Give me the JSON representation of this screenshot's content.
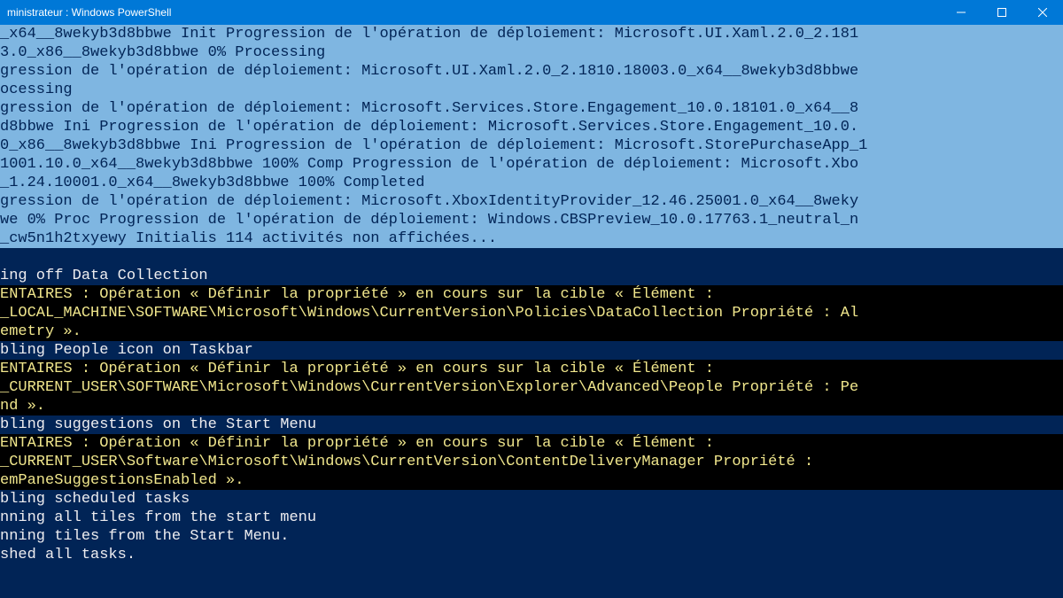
{
  "titlebar": {
    "title": "ministrateur : Windows PowerShell"
  },
  "terminal": {
    "selected_lines": [
      "_x64__8wekyb3d8bbwe Init Progression de l'opération de déploiement: Microsoft.UI.Xaml.2.0_2.181",
      "3.0_x86__8wekyb3d8bbwe 0% Processing",
      "gression de l'opération de déploiement: Microsoft.UI.Xaml.2.0_2.1810.18003.0_x64__8wekyb3d8bbwe",
      "ocessing",
      "gression de l'opération de déploiement: Microsoft.Services.Store.Engagement_10.0.18101.0_x64__8",
      "d8bbwe Ini Progression de l'opération de déploiement: Microsoft.Services.Store.Engagement_10.0.",
      "0_x86__8wekyb3d8bbwe Ini Progression de l'opération de déploiement: Microsoft.StorePurchaseApp_1",
      "1001.10.0_x64__8wekyb3d8bbwe 100% Comp Progression de l'opération de déploiement: Microsoft.Xbo",
      "_1.24.10001.0_x64__8wekyb3d8bbwe 100% Completed",
      "gression de l'opération de déploiement: Microsoft.XboxIdentityProvider_12.46.25001.0_x64__8weky",
      "we 0% Proc Progression de l'opération de déploiement: Windows.CBSPreview_10.0.17763.1_neutral_n",
      "_cw5n1h2txyewy Initialis 114 activités non affichées..."
    ],
    "body_lines": [
      {
        "style": "plain",
        "text": "ing off Data Collection"
      },
      {
        "style": "verbose",
        "text": "ENTAIRES : Opération « Définir la propriété » en cours sur la cible « Élément :"
      },
      {
        "style": "verbose",
        "text": "_LOCAL_MACHINE\\SOFTWARE\\Microsoft\\Windows\\CurrentVersion\\Policies\\DataCollection Propriété : Al"
      },
      {
        "style": "verbose",
        "text": "emetry »."
      },
      {
        "style": "plain",
        "text": "bling People icon on Taskbar"
      },
      {
        "style": "verbose",
        "text": "ENTAIRES : Opération « Définir la propriété » en cours sur la cible « Élément :"
      },
      {
        "style": "verbose",
        "text": "_CURRENT_USER\\SOFTWARE\\Microsoft\\Windows\\CurrentVersion\\Explorer\\Advanced\\People Propriété : Pe"
      },
      {
        "style": "verbose",
        "text": "nd »."
      },
      {
        "style": "plain",
        "text": "bling suggestions on the Start Menu"
      },
      {
        "style": "verbose",
        "text": "ENTAIRES : Opération « Définir la propriété » en cours sur la cible « Élément :"
      },
      {
        "style": "verbose",
        "text": "_CURRENT_USER\\Software\\Microsoft\\Windows\\CurrentVersion\\ContentDeliveryManager Propriété :"
      },
      {
        "style": "verbose",
        "text": "emPaneSuggestionsEnabled »."
      },
      {
        "style": "plain",
        "text": "bling scheduled tasks"
      },
      {
        "style": "plain",
        "text": "nning all tiles from the start menu"
      },
      {
        "style": "plain",
        "text": "nning tiles from the Start Menu."
      },
      {
        "style": "plain",
        "text": "shed all tasks."
      }
    ]
  }
}
